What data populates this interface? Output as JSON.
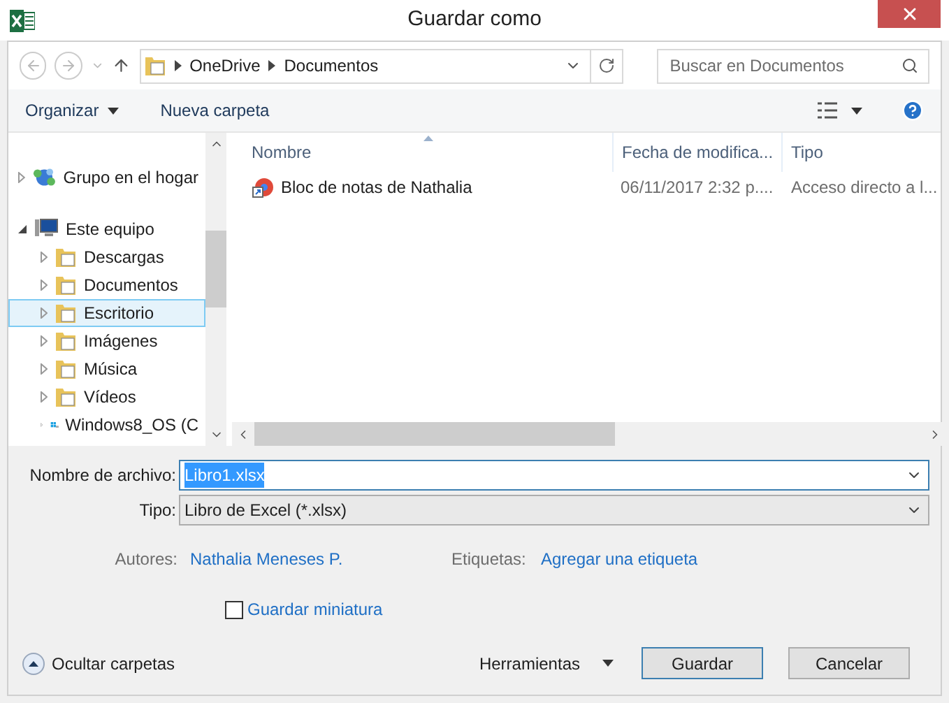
{
  "window": {
    "title": "Guardar como"
  },
  "address": {
    "path": [
      "OneDrive",
      "Documentos"
    ],
    "search_placeholder": "Buscar en Documentos"
  },
  "toolbar": {
    "organize": "Organizar",
    "new_folder": "Nueva carpeta"
  },
  "nav": [
    {
      "label": "Grupo en el hogar",
      "kind": "homegroup",
      "expanded": false,
      "selected": false
    },
    {
      "label": "Este equipo",
      "kind": "computer",
      "expanded": true,
      "selected": false,
      "children": [
        {
          "label": "Descargas",
          "kind": "folder",
          "expanded": false,
          "selected": false
        },
        {
          "label": "Documentos",
          "kind": "folder",
          "expanded": false,
          "selected": false
        },
        {
          "label": "Escritorio",
          "kind": "folder",
          "expanded": false,
          "selected": true
        },
        {
          "label": "Imágenes",
          "kind": "folder",
          "expanded": false,
          "selected": false
        },
        {
          "label": "Música",
          "kind": "folder",
          "expanded": false,
          "selected": false
        },
        {
          "label": "Vídeos",
          "kind": "folder",
          "expanded": false,
          "selected": false
        },
        {
          "label": "Windows8_OS (C",
          "kind": "drive",
          "expanded": false,
          "selected": false
        }
      ]
    }
  ],
  "table": {
    "columns": [
      "Nombre",
      "Fecha de modifica...",
      "Tipo"
    ],
    "rows": [
      {
        "cells": [
          "Bloc de notas de Nathalia",
          "06/11/2017 2:32 p....",
          "Acceso directo a l..."
        ]
      }
    ]
  },
  "form": {
    "file_name_label": "Nombre de archivo:",
    "file_name": "Libro1.xlsx",
    "file_name_selected": true,
    "type_label": "Tipo:",
    "type": "Libro de Excel (*.xlsx)",
    "authors_label": "Autores:",
    "authors": "Nathalia Meneses P.",
    "tags_label": "Etiquetas:",
    "tags": "Agregar una etiqueta",
    "thumbnail": {
      "label": "Guardar miniatura",
      "checked": false
    }
  },
  "footer": {
    "hide_folders": "Ocultar carpetas",
    "tools": "Herramientas",
    "buttons": [
      "Guardar",
      "Cancelar"
    ]
  }
}
